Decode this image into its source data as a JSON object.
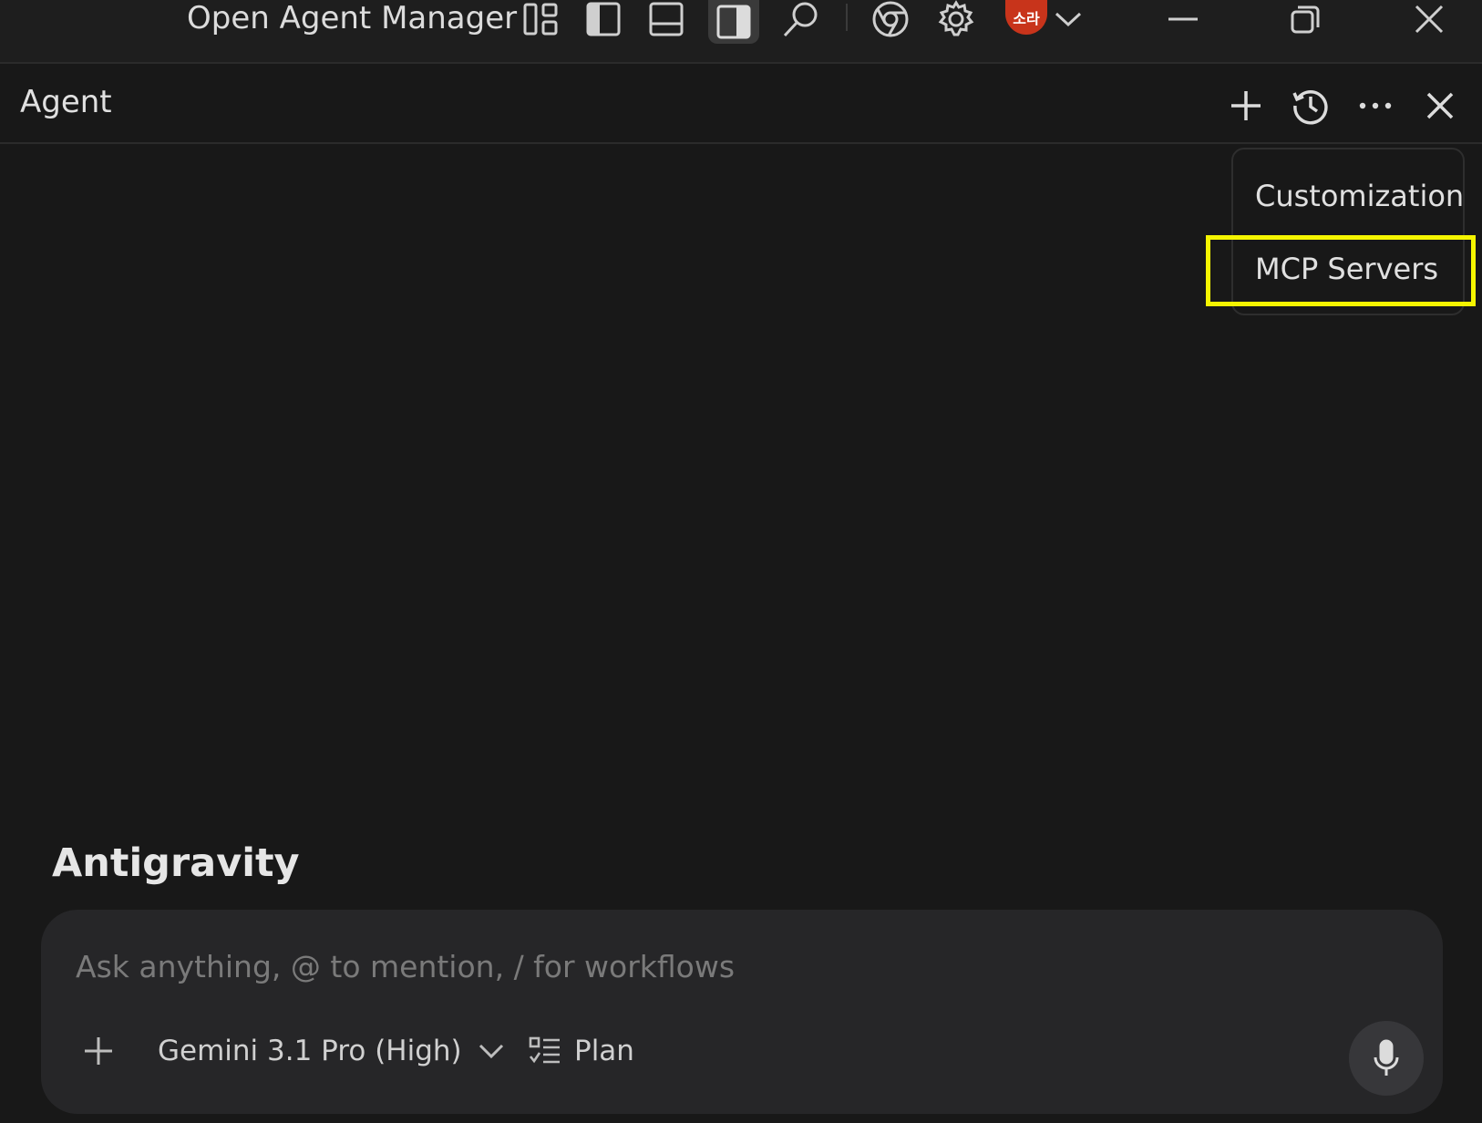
{
  "titlebar": {
    "app_title": "Open Agent Manager",
    "avatar_text": "소라"
  },
  "agent_header": {
    "title": "Agent"
  },
  "menu": {
    "items": [
      {
        "label": "Customization"
      },
      {
        "label": "MCP Servers"
      }
    ]
  },
  "brand": {
    "name": "Antigravity"
  },
  "composer": {
    "placeholder": "Ask anything, @ to mention, / for workflows",
    "value": "",
    "model_label": "Gemini 3.1 Pro (High)",
    "mode_label": "Plan"
  },
  "colors": {
    "background": "#181818",
    "titlebar": "#1e1e1e",
    "composer": "#262628",
    "avatar": "#c8341b",
    "highlight": "#f5f500"
  }
}
